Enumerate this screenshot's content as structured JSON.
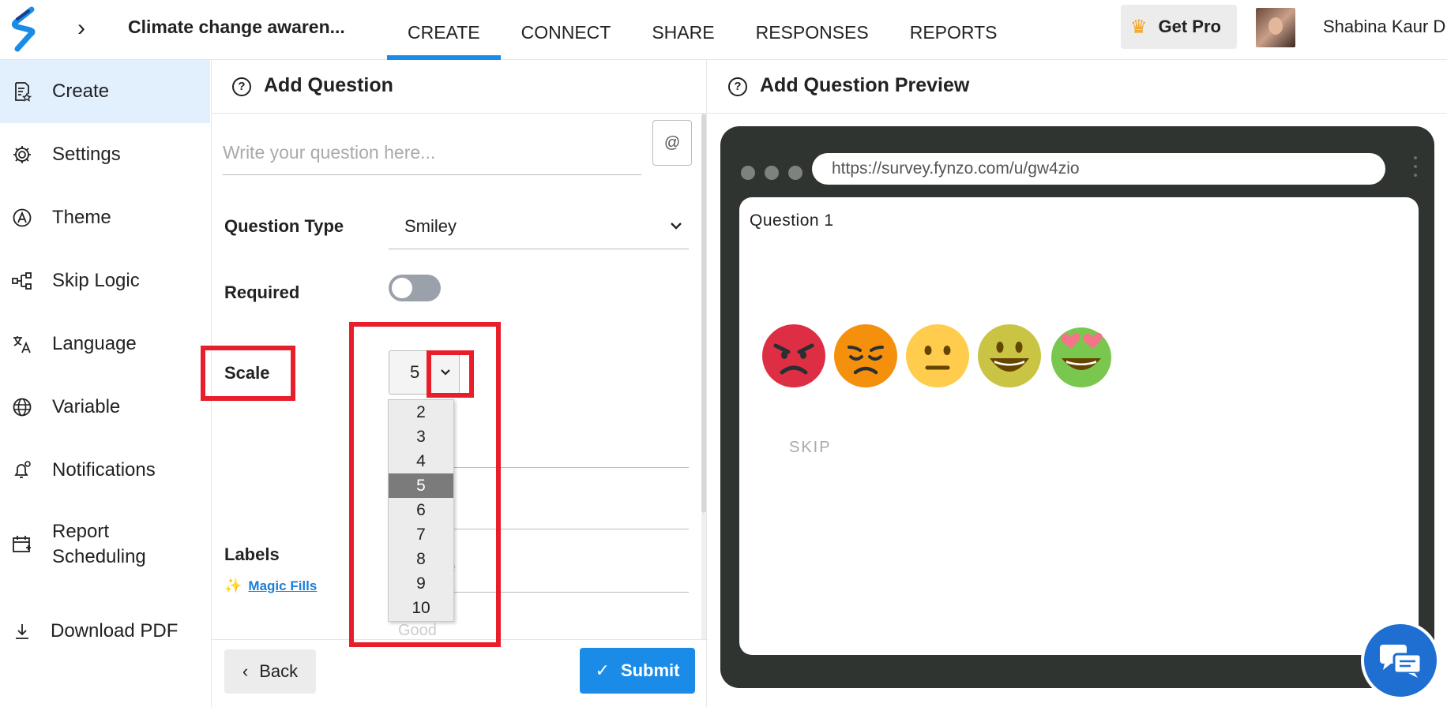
{
  "header": {
    "survey_title": "Climate change awaren...",
    "tabs": [
      {
        "label": "CREATE",
        "active": true
      },
      {
        "label": "CONNECT",
        "active": false
      },
      {
        "label": "SHARE",
        "active": false
      },
      {
        "label": "RESPONSES",
        "active": false
      },
      {
        "label": "REPORTS",
        "active": false
      }
    ],
    "get_pro_label": "Get Pro",
    "user_name": "Shabina Kaur D",
    "accent_color": "#1a8ce8"
  },
  "sidebar": {
    "items": [
      {
        "label": "Create",
        "icon": "form-star-icon",
        "active": true
      },
      {
        "label": "Settings",
        "icon": "gear-icon",
        "active": false
      },
      {
        "label": "Theme",
        "icon": "theme-icon",
        "active": false
      },
      {
        "label": "Skip Logic",
        "icon": "flow-icon",
        "active": false
      },
      {
        "label": "Language",
        "icon": "translate-icon",
        "active": false
      },
      {
        "label": "Variable",
        "icon": "globe-icon",
        "active": false
      },
      {
        "label": "Notifications",
        "icon": "bell-icon",
        "active": false
      },
      {
        "label": "Report Scheduling",
        "icon": "calendar-icon",
        "active": false
      },
      {
        "label": "Download PDF",
        "icon": "download-icon",
        "active": false
      }
    ]
  },
  "form": {
    "title": "Add Question",
    "question_placeholder": "Write your question here...",
    "at_label": "@",
    "question_type_label": "Question Type",
    "question_type_value": "Smiley",
    "required_label": "Required",
    "required_on": false,
    "scale_label": "Scale",
    "scale_value": "5",
    "scale_options": [
      "2",
      "3",
      "4",
      "5",
      "6",
      "7",
      "8",
      "9",
      "10"
    ],
    "labels_label": "Labels",
    "magic_fills_label": "Magic Fills",
    "hidden_field_fragment": "e",
    "hidden_field_good": "Good",
    "back_label": "Back",
    "submit_label": "Submit"
  },
  "preview": {
    "title": "Add Question Preview",
    "url": "https://survey.fynzo.com/u/gw4zio",
    "question_label": "Question 1",
    "smileys": [
      "angry-face-icon",
      "disappointed-face-icon",
      "neutral-face-icon",
      "smiling-face-icon",
      "heart-eyes-face-icon"
    ],
    "skip_label": "SKIP"
  },
  "annotation_color": "#e81f2a"
}
